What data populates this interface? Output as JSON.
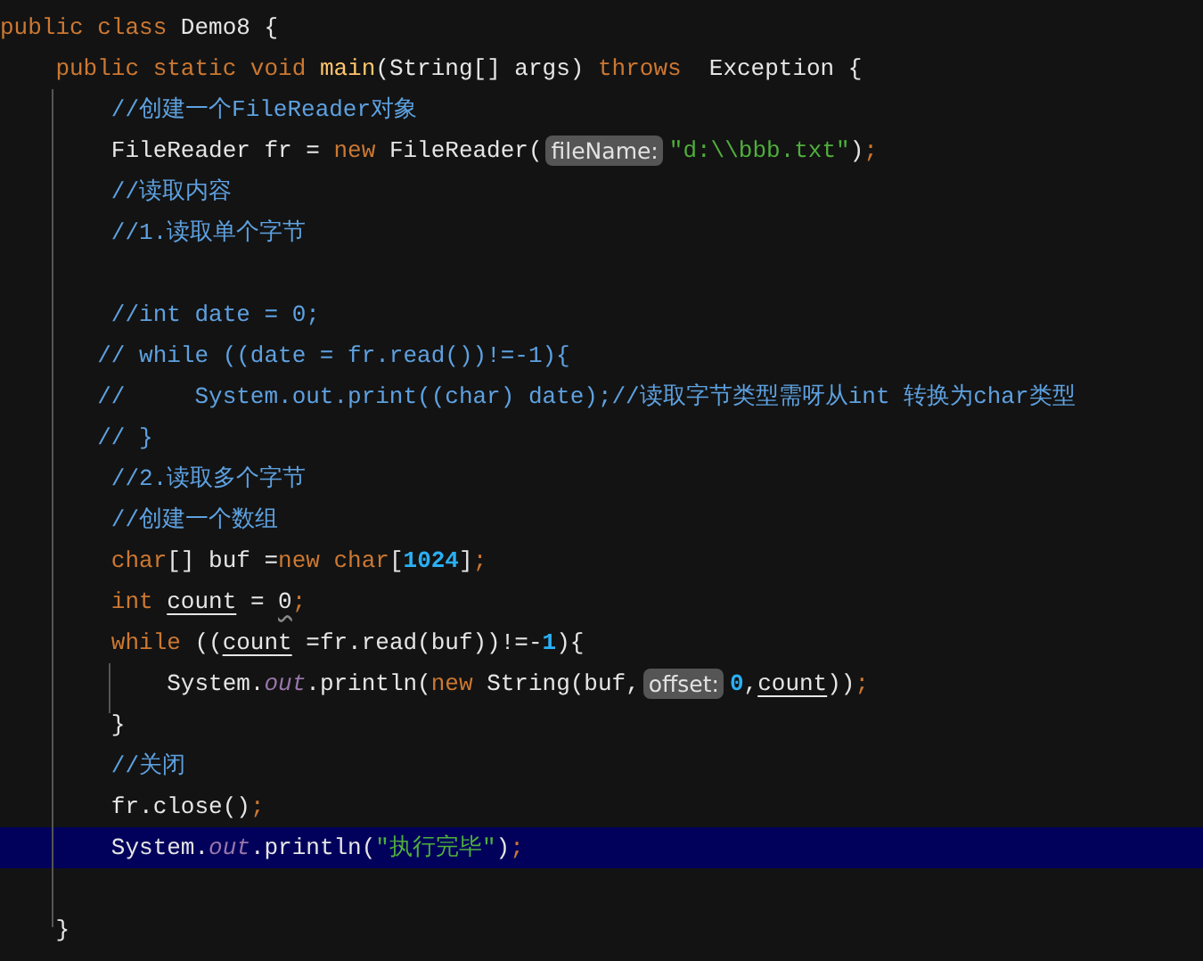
{
  "editor": {
    "lines": [
      {
        "selected": false,
        "segments": [
          {
            "kind": "code",
            "tokens": [
              {
                "kind": "kw",
                "text": "public class"
              },
              {
                "kind": "plain",
                "text": " Demo8 {"
              }
            ]
          }
        ]
      },
      {
        "selected": false,
        "segments": [
          {
            "kind": "code",
            "tokens": [
              {
                "kind": "kw",
                "text": "    public static void "
              },
              {
                "kind": "fn",
                "text": "main"
              },
              {
                "kind": "plain",
                "text": "(String[] args) "
              },
              {
                "kind": "kw",
                "text": "throws"
              },
              {
                "kind": "plain",
                "text": "  Exception {"
              }
            ]
          }
        ]
      },
      {
        "selected": false,
        "segments": [
          {
            "kind": "code",
            "tokens": [
              {
                "kind": "cmt",
                "text": "        //创建一个FileReader对象"
              }
            ]
          }
        ]
      },
      {
        "selected": false,
        "segments": [
          {
            "kind": "code",
            "tokens": [
              {
                "kind": "plain",
                "text": "        FileReader fr = "
              },
              {
                "kind": "kw",
                "text": "new"
              },
              {
                "kind": "plain",
                "text": " FileReader("
              }
            ]
          },
          {
            "kind": "hint",
            "text": "fileName:"
          },
          {
            "kind": "code",
            "tokens": [
              {
                "kind": "str",
                "text": "\"d:\\\\bbb.txt\""
              },
              {
                "kind": "plain",
                "text": ")"
              },
              {
                "kind": "kw",
                "text": ";"
              }
            ]
          }
        ]
      },
      {
        "selected": false,
        "segments": [
          {
            "kind": "code",
            "tokens": [
              {
                "kind": "cmt",
                "text": "        //读取内容"
              }
            ]
          }
        ]
      },
      {
        "selected": false,
        "segments": [
          {
            "kind": "code",
            "tokens": [
              {
                "kind": "cmt",
                "text": "        //1.读取单个字节"
              }
            ]
          }
        ]
      },
      {
        "selected": false
      },
      {
        "selected": false,
        "segments": [
          {
            "kind": "code",
            "tokens": [
              {
                "kind": "cmt",
                "text": "        //int date = 0;"
              }
            ]
          }
        ]
      },
      {
        "selected": false,
        "segments": [
          {
            "kind": "code",
            "tokens": [
              {
                "kind": "cmt",
                "text": "       // while ((date = fr.read())!=-1){"
              }
            ]
          }
        ]
      },
      {
        "selected": false,
        "segments": [
          {
            "kind": "code",
            "tokens": [
              {
                "kind": "cmt",
                "text": "       //     System.out.print((char) date);//读取字节类型需呀从int 转换为char类型"
              }
            ]
          }
        ]
      },
      {
        "selected": false,
        "segments": [
          {
            "kind": "code",
            "tokens": [
              {
                "kind": "cmt",
                "text": "       // }"
              }
            ]
          }
        ]
      },
      {
        "selected": false,
        "segments": [
          {
            "kind": "code",
            "tokens": [
              {
                "kind": "cmt",
                "text": "        //2.读取多个字节"
              }
            ]
          }
        ]
      },
      {
        "selected": false,
        "segments": [
          {
            "kind": "code",
            "tokens": [
              {
                "kind": "cmt",
                "text": "        //创建一个数组"
              }
            ]
          }
        ]
      },
      {
        "selected": false,
        "segments": [
          {
            "kind": "code",
            "tokens": [
              {
                "kind": "kw",
                "text": "        char"
              },
              {
                "kind": "plain",
                "text": "[] buf ="
              },
              {
                "kind": "kw",
                "text": "new char"
              },
              {
                "kind": "plain",
                "text": "["
              },
              {
                "kind": "num",
                "text": "1024"
              },
              {
                "kind": "plain",
                "text": "]"
              },
              {
                "kind": "kw",
                "text": ";"
              }
            ]
          }
        ]
      },
      {
        "selected": false,
        "segments": [
          {
            "kind": "code",
            "tokens": [
              {
                "kind": "kw",
                "text": "        int "
              },
              {
                "kind": "var",
                "text": "count"
              },
              {
                "kind": "plain",
                "text": " = "
              },
              {
                "kind": "warn",
                "text": "0"
              },
              {
                "kind": "kw",
                "text": ";"
              }
            ]
          }
        ]
      },
      {
        "selected": false,
        "segments": [
          {
            "kind": "code",
            "tokens": [
              {
                "kind": "kw",
                "text": "        while"
              },
              {
                "kind": "plain",
                "text": " (("
              },
              {
                "kind": "var",
                "text": "count"
              },
              {
                "kind": "plain",
                "text": " =fr.read(buf))!=-"
              },
              {
                "kind": "num",
                "text": "1"
              },
              {
                "kind": "plain",
                "text": "){"
              }
            ]
          }
        ]
      },
      {
        "selected": false,
        "segments": [
          {
            "kind": "code",
            "tokens": [
              {
                "kind": "plain",
                "text": "            System."
              },
              {
                "kind": "field",
                "text": "out"
              },
              {
                "kind": "plain",
                "text": ".println("
              },
              {
                "kind": "kw",
                "text": "new"
              },
              {
                "kind": "plain",
                "text": " String(buf,"
              }
            ]
          },
          {
            "kind": "hint",
            "text": "offset:"
          },
          {
            "kind": "code",
            "tokens": [
              {
                "kind": "num",
                "text": "0"
              },
              {
                "kind": "plain",
                "text": ","
              },
              {
                "kind": "var",
                "text": "count"
              },
              {
                "kind": "plain",
                "text": "))"
              },
              {
                "kind": "kw",
                "text": ";"
              }
            ]
          }
        ]
      },
      {
        "selected": false,
        "segments": [
          {
            "kind": "code",
            "tokens": [
              {
                "kind": "plain",
                "text": "        }"
              }
            ]
          }
        ]
      },
      {
        "selected": false,
        "segments": [
          {
            "kind": "code",
            "tokens": [
              {
                "kind": "cmt",
                "text": "        //关闭"
              }
            ]
          }
        ]
      },
      {
        "selected": false,
        "segments": [
          {
            "kind": "code",
            "tokens": [
              {
                "kind": "plain",
                "text": "        fr.close()"
              },
              {
                "kind": "kw",
                "text": ";"
              }
            ]
          }
        ]
      },
      {
        "selected": true,
        "segments": [
          {
            "kind": "code",
            "tokens": [
              {
                "kind": "plain",
                "text": "        System."
              },
              {
                "kind": "field",
                "text": "out"
              },
              {
                "kind": "plain",
                "text": ".println("
              },
              {
                "kind": "str",
                "text": "\"执行完毕\""
              },
              {
                "kind": "plain",
                "text": ")"
              },
              {
                "kind": "kw",
                "text": ";"
              }
            ]
          }
        ]
      },
      {
        "selected": false
      },
      {
        "selected": false,
        "segments": [
          {
            "kind": "code",
            "tokens": [
              {
                "kind": "plain",
                "text": "    }"
              }
            ]
          }
        ]
      }
    ]
  }
}
